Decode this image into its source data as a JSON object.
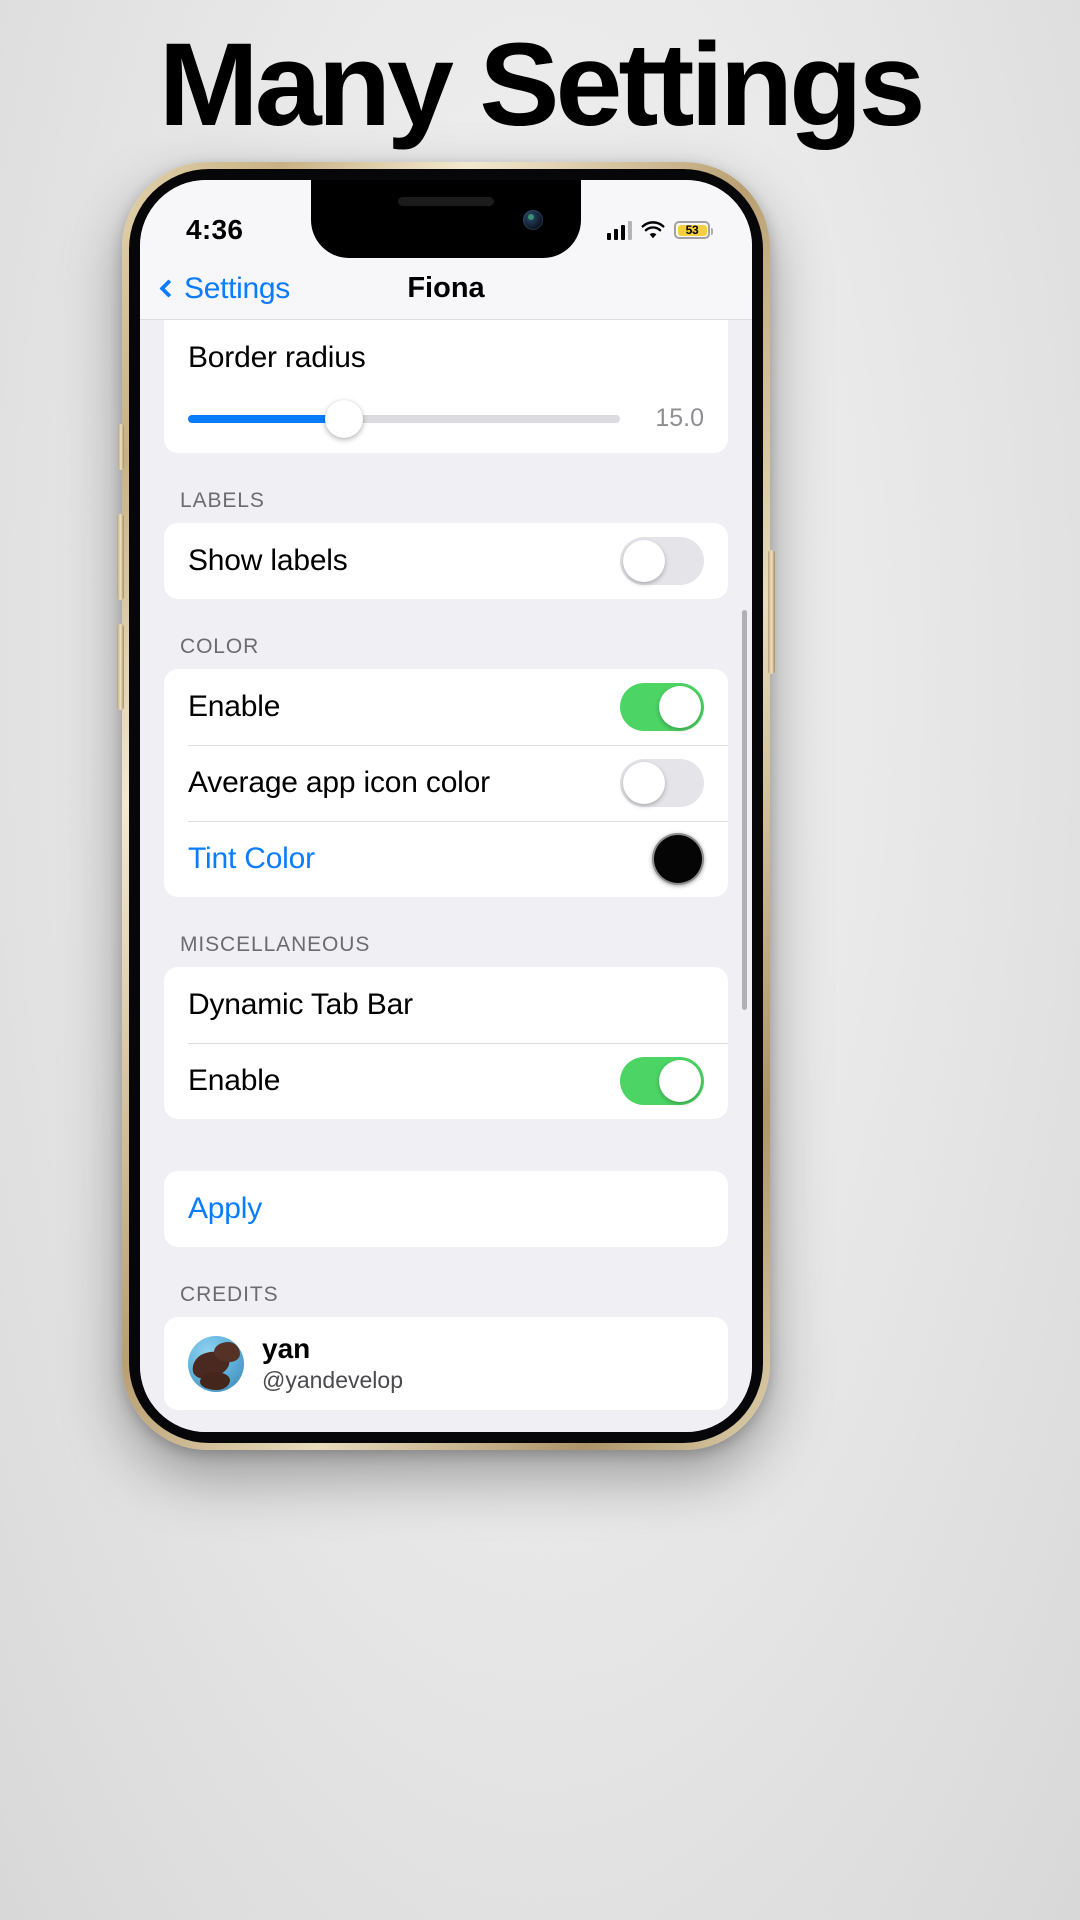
{
  "headline": "Many Settings",
  "status_bar": {
    "time": "4:36",
    "signal_icon": "cellular-signal-icon",
    "wifi_icon": "wifi-icon",
    "battery_percent": "53"
  },
  "nav": {
    "back_label": "Settings",
    "back_icon": "chevron-left-icon",
    "title": "Fiona"
  },
  "sections": {
    "border_radius": {
      "row_label": "Border radius",
      "slider_value": "15.0"
    },
    "labels": {
      "header": "LABELS",
      "rows": [
        {
          "label": "Show labels",
          "toggle": "off"
        }
      ]
    },
    "color": {
      "header": "COLOR",
      "rows": [
        {
          "label": "Enable",
          "toggle": "on"
        },
        {
          "label": "Average app icon color",
          "toggle": "off"
        },
        {
          "label": "Tint Color",
          "swatch": "#050505"
        }
      ]
    },
    "miscellaneous": {
      "header": "MISCELLANEOUS",
      "rows": [
        {
          "label": "Dynamic Tab Bar"
        },
        {
          "label": "Enable",
          "toggle": "on"
        }
      ]
    },
    "apply": {
      "label": "Apply"
    },
    "credits": {
      "header": "CREDITS",
      "name": "yan",
      "handle": "@yandevelop",
      "avatar_icon": "avatar"
    }
  },
  "colors": {
    "accent_blue": "#0a7cff",
    "toggle_green": "#4cd464",
    "battery_yellow": "#f5cf3d",
    "group_bg": "#ffffff",
    "page_bg": "#efeff4"
  }
}
